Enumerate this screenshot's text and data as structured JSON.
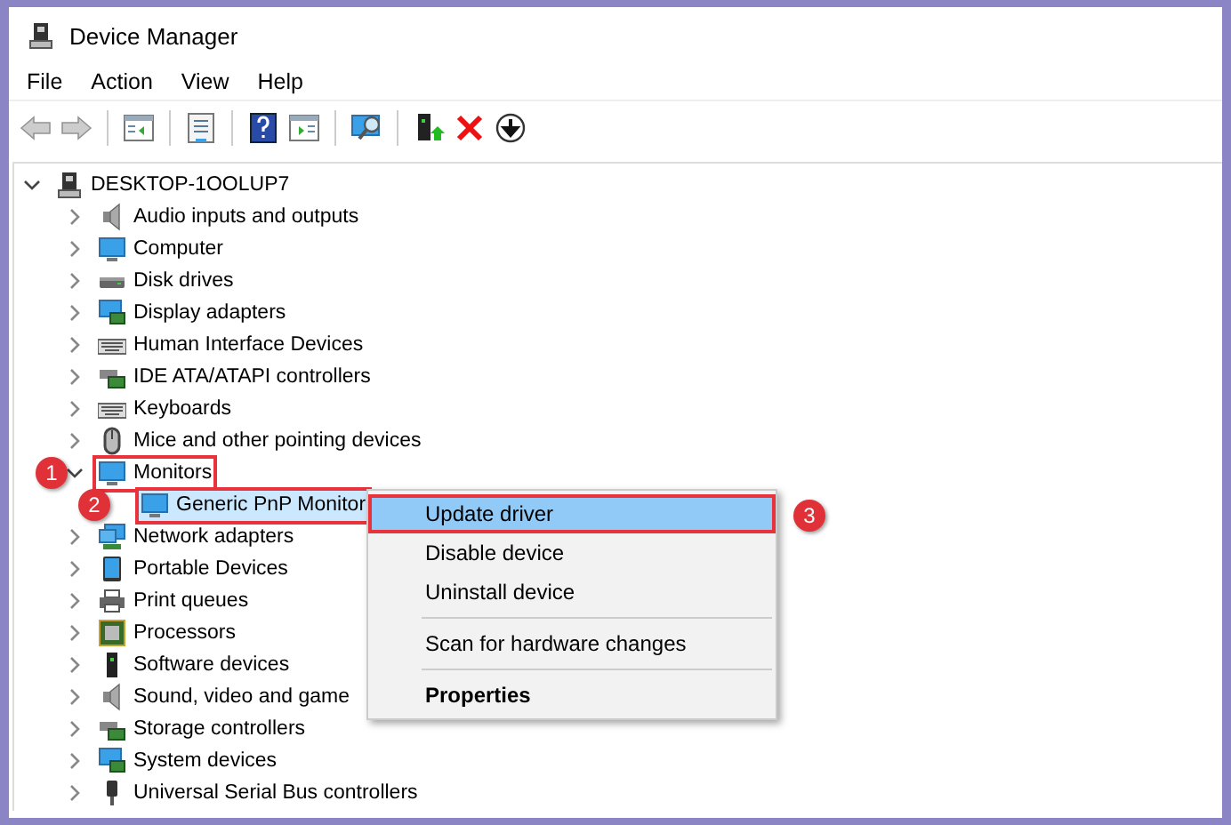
{
  "window": {
    "title": "Device Manager"
  },
  "menu_bar": [
    "File",
    "Action",
    "View",
    "Help"
  ],
  "toolbar": [
    {
      "kind": "back",
      "disabled": true
    },
    {
      "kind": "forward",
      "disabled": true
    },
    {
      "kind": "separator"
    },
    {
      "kind": "tree-pane",
      "disabled": false
    },
    {
      "kind": "separator"
    },
    {
      "kind": "properties",
      "disabled": false
    },
    {
      "kind": "separator"
    },
    {
      "kind": "help",
      "disabled": false
    },
    {
      "kind": "action-pane",
      "disabled": false
    },
    {
      "kind": "separator"
    },
    {
      "kind": "scan",
      "disabled": false
    },
    {
      "kind": "separator"
    },
    {
      "kind": "update",
      "disabled": false
    },
    {
      "kind": "uninstall",
      "disabled": false
    },
    {
      "kind": "disable",
      "disabled": false
    }
  ],
  "tree": [
    {
      "label": "DESKTOP-1OOLUP7",
      "expanded": true,
      "selected": false,
      "children": [
        {
          "label": "Audio inputs and outputs",
          "expanded": false,
          "selected": false
        },
        {
          "label": "Computer",
          "expanded": false,
          "selected": false
        },
        {
          "label": "Disk drives",
          "expanded": false,
          "selected": false
        },
        {
          "label": "Display adapters",
          "expanded": false,
          "selected": false
        },
        {
          "label": "Human Interface Devices",
          "expanded": false,
          "selected": false
        },
        {
          "label": "IDE ATA/ATAPI controllers",
          "expanded": false,
          "selected": false
        },
        {
          "label": "Keyboards",
          "expanded": false,
          "selected": false
        },
        {
          "label": "Mice and other pointing devices",
          "expanded": false,
          "selected": false
        },
        {
          "label": "Monitors",
          "expanded": true,
          "selected": false,
          "marker": "1",
          "children": [
            {
              "label": "Generic PnP Monitor",
              "selected": true,
              "marker": "2"
            }
          ]
        },
        {
          "label": "Network adapters",
          "expanded": false,
          "selected": false
        },
        {
          "label": "Portable Devices",
          "expanded": false,
          "selected": false
        },
        {
          "label": "Print queues",
          "expanded": false,
          "selected": false
        },
        {
          "label": "Processors",
          "expanded": false,
          "selected": false
        },
        {
          "label": "Software devices",
          "expanded": false,
          "selected": false
        },
        {
          "label": "Sound, video and game",
          "expanded": false,
          "selected": false
        },
        {
          "label": "Storage controllers",
          "expanded": false,
          "selected": false
        },
        {
          "label": "System devices",
          "expanded": false,
          "selected": false
        },
        {
          "label": "Universal Serial Bus controllers",
          "expanded": false,
          "selected": false
        }
      ]
    }
  ],
  "context_menu": {
    "groups": [
      [
        {
          "label": "Update driver",
          "selected": true,
          "default": false,
          "marker": "3"
        },
        {
          "label": "Disable device",
          "selected": false,
          "default": false
        },
        {
          "label": "Uninstall device",
          "selected": false,
          "default": false
        }
      ],
      [
        {
          "label": "Scan for hardware changes",
          "selected": false,
          "default": false
        }
      ],
      [
        {
          "label": "Properties",
          "selected": false,
          "default": true
        }
      ]
    ]
  }
}
